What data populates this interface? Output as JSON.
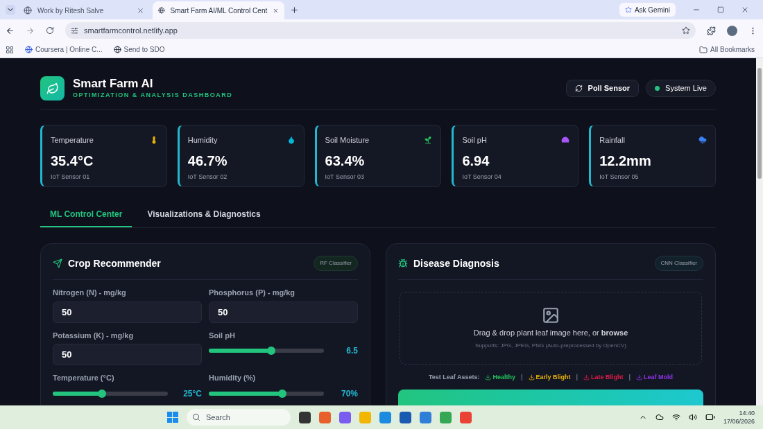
{
  "browser": {
    "tabs": [
      {
        "title": "Work by Ritesh Salve",
        "selected": false
      },
      {
        "title": "Smart Farm AI/ML Control Cent",
        "selected": true
      }
    ],
    "ask_gemini": "Ask Gemini",
    "url": "smartfarmcontrol.netlify.app",
    "bookmarks": [
      "Coursera | Online C...",
      "Send to SDO"
    ],
    "all_bookmarks": "All Bookmarks"
  },
  "header": {
    "title": "Smart Farm AI",
    "subtitle": "OPTIMIZATION & ANALYSIS DASHBOARD",
    "poll_button": "Poll Sensor",
    "status": {
      "label": "System Live",
      "live": true
    }
  },
  "sensors": [
    {
      "label": "Temperature",
      "value": "35.4°C",
      "source": "IoT Sensor 01",
      "color": "#eab308"
    },
    {
      "label": "Humidity",
      "value": "46.7%",
      "source": "IoT Sensor 02",
      "color": "#06b6d4"
    },
    {
      "label": "Soil Moisture",
      "value": "63.4%",
      "source": "IoT Sensor 03",
      "color": "#22c55e"
    },
    {
      "label": "Soil pH",
      "value": "6.94",
      "source": "IoT Sensor 04",
      "color": "#a855f7"
    },
    {
      "label": "Rainfall",
      "value": "12.2mm",
      "source": "IoT Sensor 05",
      "color": "#3b82f6"
    }
  ],
  "tabs": [
    {
      "label": "ML Control Center",
      "selected": true
    },
    {
      "label": "Visualizations & Diagnostics",
      "selected": false
    }
  ],
  "crop": {
    "title": "Crop Recommender",
    "badge": "RF Classifier",
    "fields": [
      {
        "kind": "input",
        "label": "Nitrogen (N) - mg/kg",
        "value": "50"
      },
      {
        "kind": "input",
        "label": "Phosphorus (P) - mg/kg",
        "value": "50"
      },
      {
        "kind": "input",
        "label": "Potassium (K) - mg/kg",
        "value": "50"
      },
      {
        "kind": "slider",
        "label": "Soil pH",
        "level": 0.54,
        "reading": "6.5"
      },
      {
        "kind": "slider",
        "label": "Temperature (°C)",
        "level": 0.43,
        "reading": "25°C"
      },
      {
        "kind": "slider",
        "label": "Humidity (%)",
        "level": 0.64,
        "reading": "70%"
      }
    ]
  },
  "disease": {
    "title": "Disease Diagnosis",
    "badge": "CNN Classifier",
    "drop_text": "Drag & drop plant leaf image here, or **browse**",
    "support": "Supports: JPG, JPEG, PNG (Auto-preprocessed by OpenCV)",
    "assets_label": "Test Leaf Assets:",
    "separator": "|",
    "assets": [
      {
        "label": "Healthy",
        "color": "#22c55e"
      },
      {
        "label": "Early Blight",
        "color": "#eab308"
      },
      {
        "label": "Late Blight",
        "color": "#e11d48"
      },
      {
        "label": "Leaf Mold",
        "color": "#9333ea"
      }
    ]
  },
  "taskbar": {
    "search_placeholder": "Search",
    "time": "14:40",
    "date": "17/06/2026"
  }
}
